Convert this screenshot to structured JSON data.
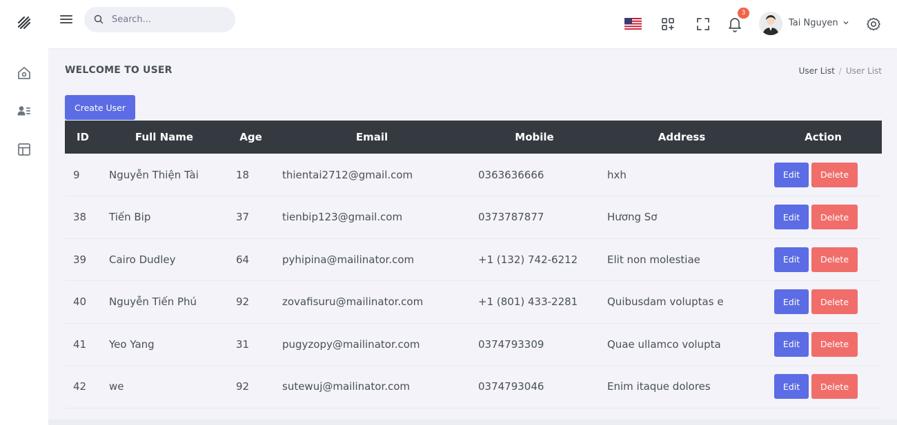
{
  "header": {
    "search_placeholder": "Search...",
    "notification_count": "3",
    "user_name": "Tai Nguyen"
  },
  "page": {
    "title": "WELCOME TO USER",
    "breadcrumb": [
      "User List",
      "User List"
    ],
    "create_button": "Create User"
  },
  "table": {
    "columns": [
      "ID",
      "Full Name",
      "Age",
      "Email",
      "Mobile",
      "Address",
      "Action"
    ],
    "rows": [
      {
        "id": "9",
        "name": "Nguyễn Thiện Tài",
        "age": "18",
        "email": "thientai2712@gmail.com",
        "mobile": "0363636666",
        "address": "hxh"
      },
      {
        "id": "38",
        "name": "Tiến Bip",
        "age": "37",
        "email": "tienbip123@gmail.com",
        "mobile": "0373787877",
        "address": "Hương Sơ"
      },
      {
        "id": "39",
        "name": "Cairo Dudley",
        "age": "64",
        "email": "pyhipina@mailinator.com",
        "mobile": "+1 (132) 742-6212",
        "address": "Elit non molestiae"
      },
      {
        "id": "40",
        "name": "Nguyễn Tiến Phú",
        "age": "92",
        "email": "zovafisuru@mailinator.com",
        "mobile": "+1 (801) 433-2281",
        "address": "Quibusdam voluptas e"
      },
      {
        "id": "41",
        "name": "Yeo Yang",
        "age": "31",
        "email": "pugyzopy@mailinator.com",
        "mobile": "0374793309",
        "address": "Quae ullamco volupta"
      },
      {
        "id": "42",
        "name": "we",
        "age": "92",
        "email": "sutewuj@mailinator.com",
        "mobile": "0374793046",
        "address": "Enim itaque dolores"
      }
    ],
    "edit_label": "Edit",
    "delete_label": "Delete"
  },
  "icons": {
    "logo": "logo-stripes-icon",
    "menu": "hamburger-menu-icon",
    "search": "search-icon",
    "flag": "us-flag-icon",
    "apps": "apps-grid-icon",
    "fullscreen": "fullscreen-icon",
    "bell": "bell-icon",
    "settings": "gear-icon",
    "sidebar": [
      "home-icon",
      "user-list-icon",
      "layout-icon"
    ]
  },
  "colors": {
    "primary": "#5c6ce4",
    "danger": "#f06d6a",
    "table_header": "#343a40",
    "badge": "#f06548",
    "background": "#f3f3f9"
  }
}
